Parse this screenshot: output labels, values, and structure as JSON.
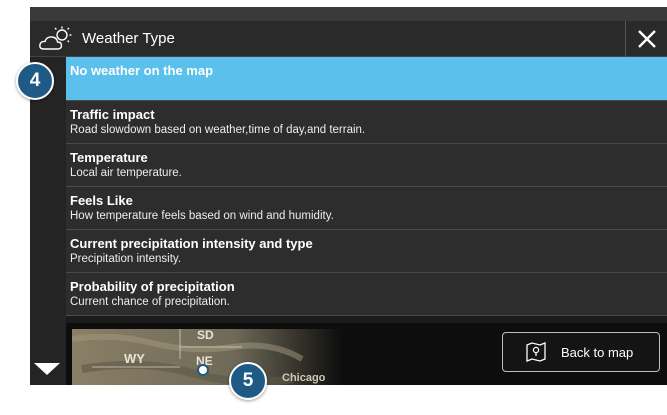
{
  "header": {
    "title": "Weather Type",
    "icon": "cloud-sun-icon",
    "close_icon": "close-icon"
  },
  "options": [
    {
      "title": "No weather on the map",
      "subtitle": "",
      "selected": true
    },
    {
      "title": "Traffic impact",
      "subtitle": "Road slowdown based on weather,time of day,and terrain.",
      "selected": false
    },
    {
      "title": "Temperature",
      "subtitle": "Local air temperature.",
      "selected": false
    },
    {
      "title": "Feels Like",
      "subtitle": "How temperature feels based on wind and humidity.",
      "selected": false
    },
    {
      "title": "Current precipitation intensity and type",
      "subtitle": "Precipitation intensity.",
      "selected": false
    },
    {
      "title": "Probability of precipitation",
      "subtitle": "Current chance of precipitation.",
      "selected": false
    }
  ],
  "map_preview": {
    "labels": [
      "SD",
      "WY",
      "NE",
      "Chicago"
    ]
  },
  "footer": {
    "back_label": "Back to map",
    "back_icon": "map-pin-icon"
  },
  "callouts": [
    "4",
    "5"
  ],
  "colors": {
    "selected": "#5bc0eb",
    "callout": "#1f5a86",
    "row": "#2d2d2d"
  }
}
